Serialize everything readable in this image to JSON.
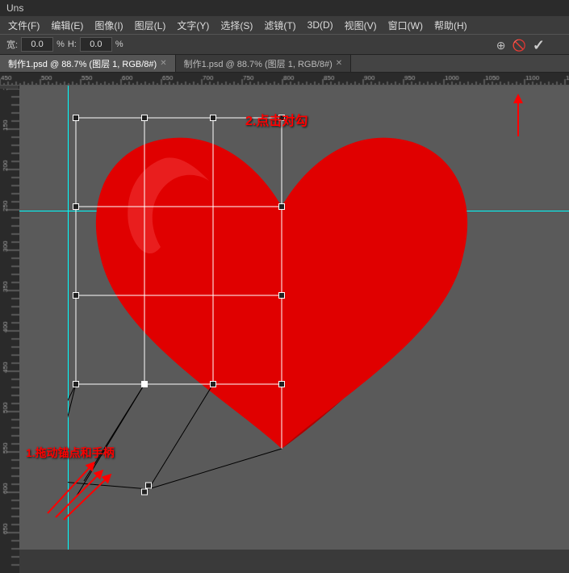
{
  "titleBar": {
    "text": "Uns"
  },
  "menuBar": {
    "items": [
      "文件(F)",
      "编辑(E)",
      "图像(I)",
      "图层(L)",
      "文字(Y)",
      "选择(S)",
      "滤镜(T)",
      "3D(D)",
      "视图(V)",
      "窗口(W)",
      "帮助(H)"
    ]
  },
  "optionsBar": {
    "label1": "宽: ",
    "value1": "0.0",
    "label2": "%",
    "label3": "H:",
    "value2": "0.0",
    "label4": "%"
  },
  "tabs": [
    {
      "name": "制作1.psd @ 88.7% (图层 1, RGB/8#)",
      "active": true
    },
    {
      "name": "制作1.psd @ 88.7% (图层 1, RGB/8#)",
      "active": false
    }
  ],
  "annotations": {
    "text1": "1.拖动锚点和手柄",
    "text2": "2.点击对勾"
  },
  "toolbarIcons": {
    "icon1": "⊕",
    "icon2": "⊘",
    "checkmark": "✓"
  },
  "colors": {
    "heartFill": "#e00000",
    "heartShadow": "#c00000",
    "annotationRed": "#ff0000",
    "background": "#5a5a5a"
  }
}
